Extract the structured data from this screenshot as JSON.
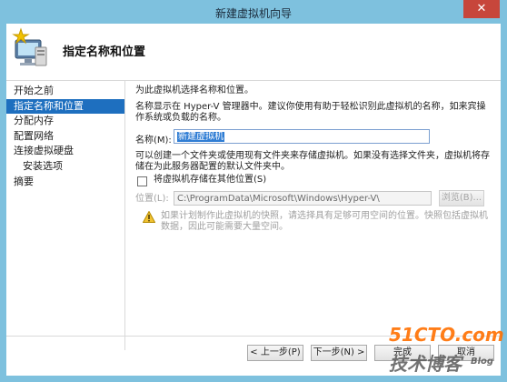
{
  "window": {
    "title": "新建虚拟机向导",
    "close_glyph": "✕"
  },
  "header": {
    "title": "指定名称和位置"
  },
  "nav": {
    "items": [
      {
        "label": "开始之前"
      },
      {
        "label": "指定名称和位置"
      },
      {
        "label": "分配内存"
      },
      {
        "label": "配置网络"
      },
      {
        "label": "连接虚拟硬盘"
      },
      {
        "label": "安装选项"
      },
      {
        "label": "摘要"
      }
    ]
  },
  "main": {
    "intro": "为此虚拟机选择名称和位置。",
    "description": "名称显示在 Hyper-V 管理器中。建议你使用有助于轻松识别此虚拟机的名称，如来宾操作系统或负载的名称。",
    "name_label": "名称(M):",
    "name_value": "新建虚拟机",
    "folder_text": "可以创建一个文件夹或使用现有文件夹来存储虚拟机。如果没有选择文件夹，虚拟机将存储在为此服务器配置的默认文件夹中。",
    "store_checkbox_label": "将虚拟机存储在其他位置(S)",
    "location_label": "位置(L):",
    "location_value": "C:\\ProgramData\\Microsoft\\Windows\\Hyper-V\\",
    "browse_label": "浏览(B)...",
    "warning_text": "如果计划制作此虚拟机的快照，请选择具有足够可用空间的位置。快照包括虚拟机数据，因此可能需要大量空间。"
  },
  "footer": {
    "prev_label": "< 上一步(P)",
    "next_label": "下一步(N) >",
    "finish_label": "完成",
    "cancel_label": "取消"
  },
  "watermark": {
    "site": "51CTO.com",
    "blog_cn": "技术博客",
    "blog_en": "Blog"
  }
}
